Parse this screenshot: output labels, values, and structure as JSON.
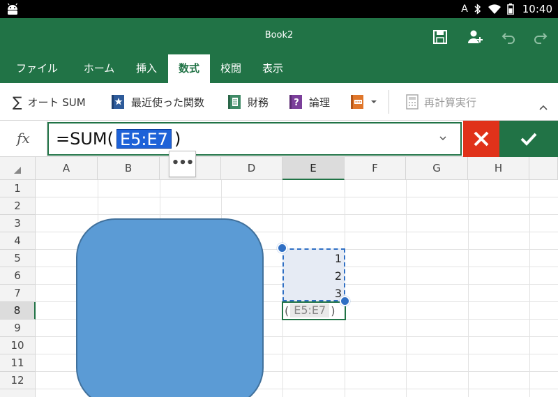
{
  "status_bar": {
    "signal": "A",
    "time": "10:40"
  },
  "titlebar": {
    "title": "Book2"
  },
  "tabs": [
    {
      "label": "ファイル",
      "active": false
    },
    {
      "label": "ホーム",
      "active": false
    },
    {
      "label": "挿入",
      "active": false
    },
    {
      "label": "数式",
      "active": true
    },
    {
      "label": "校閲",
      "active": false
    },
    {
      "label": "表示",
      "active": false
    }
  ],
  "ribbon": {
    "autosum": "オート SUM",
    "recent": "最近使った関数",
    "financial": "財務",
    "logical": "論理",
    "recalc": "再計算実行"
  },
  "formula_bar": {
    "fx_label": "fx",
    "prefix": "=SUM(",
    "reference": "E5:E7",
    "suffix": ")",
    "more": "•••"
  },
  "grid": {
    "columns": [
      "A",
      "B",
      "C",
      "D",
      "E",
      "F",
      "G",
      "H"
    ],
    "selected_column": "E",
    "rows": [
      "1",
      "2",
      "3",
      "4",
      "5",
      "6",
      "7",
      "8",
      "9",
      "10",
      "11",
      "12"
    ],
    "selected_row": "8",
    "cells": {
      "E5": "1",
      "E6": "2",
      "E7": "3"
    },
    "active_cell_open": "(",
    "active_cell_ref": "E5:E7",
    "active_cell_close": ")"
  },
  "colors": {
    "excel_green": "#217346",
    "cancel_red": "#e0321a",
    "selection_blue": "#2f6fc4",
    "shape_fill": "#5b9bd5"
  }
}
